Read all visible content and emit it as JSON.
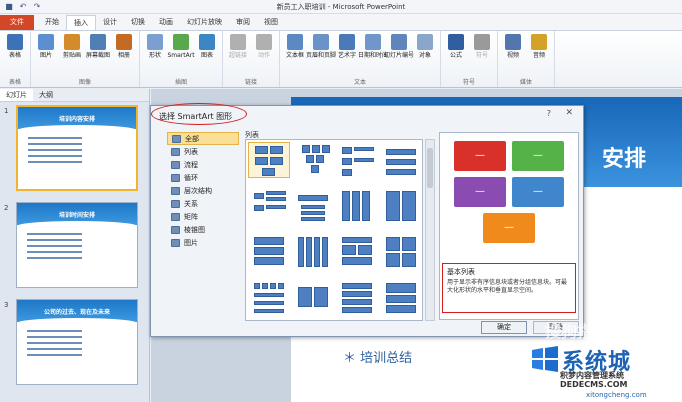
{
  "window": {
    "title": "新员工入职培训 - Microsoft PowerPoint"
  },
  "qat": [
    "save-icon",
    "undo-icon",
    "redo-icon"
  ],
  "tabs": [
    {
      "label": "文件",
      "type": "file"
    },
    {
      "label": "开始"
    },
    {
      "label": "插入",
      "active": true
    },
    {
      "label": "设计"
    },
    {
      "label": "切换"
    },
    {
      "label": "动画"
    },
    {
      "label": "幻灯片放映"
    },
    {
      "label": "审阅"
    },
    {
      "label": "视图"
    }
  ],
  "ribbon": {
    "groups": [
      {
        "label": "表格",
        "buttons": [
          {
            "label": "表格",
            "color": "#3c72b8"
          }
        ]
      },
      {
        "label": "图像",
        "buttons": [
          {
            "label": "图片",
            "color": "#5b8fcf"
          },
          {
            "label": "剪贴画",
            "color": "#d48b2c"
          },
          {
            "label": "屏幕截图",
            "color": "#4f7fb5"
          },
          {
            "label": "相册",
            "color": "#c46a24"
          }
        ]
      },
      {
        "label": "插图",
        "buttons": [
          {
            "label": "形状",
            "color": "#7a9fd0"
          },
          {
            "label": "SmartArt",
            "color": "#59a84b"
          },
          {
            "label": "图表",
            "color": "#3d86c6"
          }
        ]
      },
      {
        "label": "链接",
        "buttons": [
          {
            "label": "超链接",
            "color": "#b0b0b0",
            "dim": true
          },
          {
            "label": "动作",
            "color": "#b0b0b0",
            "dim": true
          }
        ]
      },
      {
        "label": "文本",
        "buttons": [
          {
            "label": "文本框",
            "color": "#5c88c4"
          },
          {
            "label": "页眉和页脚",
            "color": "#6a93c8"
          },
          {
            "label": "艺术字",
            "color": "#4a7ab8"
          },
          {
            "label": "日期和时间",
            "color": "#7097c9"
          },
          {
            "label": "幻灯片编号",
            "color": "#5e86bd"
          },
          {
            "label": "对象",
            "color": "#8aa6cc"
          }
        ]
      },
      {
        "label": "符号",
        "buttons": [
          {
            "label": "公式",
            "color": "#2f5f9e"
          },
          {
            "label": "符号",
            "color": "#9a9a9a",
            "dim": true
          }
        ]
      },
      {
        "label": "媒体",
        "buttons": [
          {
            "label": "视频",
            "color": "#5276ad"
          },
          {
            "label": "音频",
            "color": "#d4a229"
          }
        ]
      }
    ]
  },
  "left_panel": {
    "tabs": [
      "幻灯片",
      "大纲"
    ],
    "slides": [
      {
        "num": "1",
        "title": "培训内容安排",
        "selected": true
      },
      {
        "num": "2",
        "title": "培训时间安排"
      },
      {
        "num": "3",
        "title": "公司的过去、现在及未来"
      }
    ]
  },
  "slide": {
    "title": "安排",
    "bullet": "＊ 培训总结"
  },
  "dialog": {
    "title": "选择 SmartArt 图形",
    "help": "?",
    "close": "✕",
    "categories": [
      {
        "label": "全部",
        "active": true
      },
      {
        "label": "列表"
      },
      {
        "label": "流程"
      },
      {
        "label": "循环"
      },
      {
        "label": "层次结构"
      },
      {
        "label": "关系"
      },
      {
        "label": "矩阵"
      },
      {
        "label": "棱锥图"
      },
      {
        "label": "图片"
      }
    ],
    "gallery_header": "列表",
    "preview": {
      "colors": [
        "#d9312a",
        "#54b248",
        "#8a4cb0",
        "#3f86cc",
        "#f08a1c"
      ],
      "dash": "—",
      "desc_title": "基本列表",
      "desc_text": "用于显示非有序信息块或者分组信息块。可最大化形状的水平和垂直显示空间。"
    },
    "ok_label": "确定",
    "cancel_label": "取消"
  },
  "watermark": {
    "big": "系统城",
    "line1": "积梦内容管理系统",
    "line2": "DEDECMS.COM",
    "line3": "xitongcheng.com",
    "faint": "搜狗指南"
  }
}
